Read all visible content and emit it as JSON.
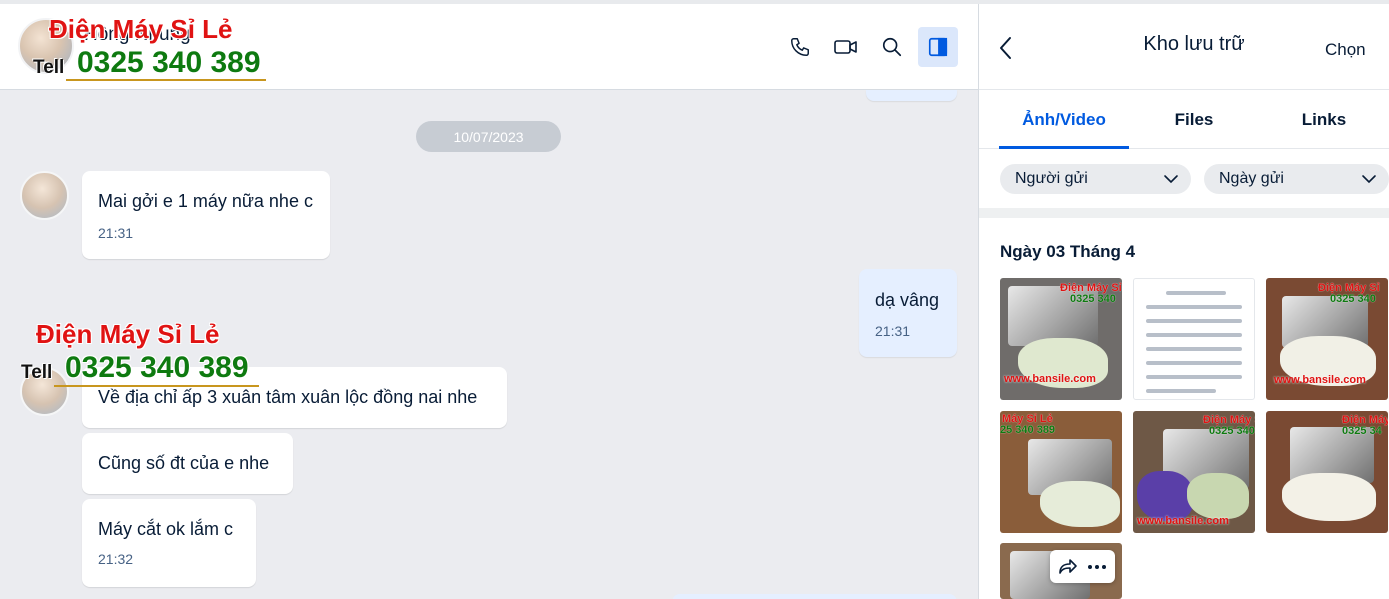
{
  "chat": {
    "header": {
      "name": "Hồng Nhung",
      "buttons": [
        "phone-icon",
        "video-icon",
        "search-icon",
        "panel-icon"
      ]
    },
    "date_separator": "10/07/2023",
    "messages": [
      {
        "text": "Mai gởi e 1 máy nữa nhe c",
        "time": "21:31",
        "from": "contact"
      },
      {
        "text": "dạ vâng",
        "time": "21:31",
        "from": "me"
      },
      {
        "text": "Về địa chỉ ấp 3 xuân tâm xuân lộc đồng nai nhe",
        "time": "",
        "from": "contact"
      },
      {
        "text": "Cũng số đt của e nhe",
        "time": "",
        "from": "contact"
      },
      {
        "text": "Máy cắt ok lắm c",
        "time": "21:32",
        "from": "contact"
      }
    ]
  },
  "watermark": {
    "brand": "Điện Máy Sỉ Lẻ",
    "tell": "Tell",
    "phone": "0325 340 389"
  },
  "panel": {
    "title": "Kho lưu trữ",
    "select_label": "Chọn",
    "tabs": [
      "Ảnh/Video",
      "Files",
      "Links"
    ],
    "active_tab": 0,
    "filters": {
      "sender": "Người gửi",
      "date": "Ngày gửi"
    },
    "section_title": "Ngày 03 Tháng 4",
    "thumbs": [
      {
        "wm_brand": "Điện Máy Sỉ",
        "wm_phone": "0325 340",
        "site": "www.bansile.com"
      },
      {
        "wm_brand": "",
        "wm_phone": "",
        "site": ""
      },
      {
        "wm_brand": "Điện Máy Sỉ",
        "wm_phone": "0325 340",
        "site": "www.bansile.com"
      },
      {
        "wm_brand": "Máy Sỉ Lẻ",
        "wm_phone": "25 340 389",
        "site": ""
      },
      {
        "wm_brand": "Điện Máy S",
        "wm_phone": "0325 340",
        "site": "www.bansile.com"
      },
      {
        "wm_brand": "Điện Máy",
        "wm_phone": "0325 34",
        "site": ""
      },
      {
        "wm_brand": "",
        "wm_phone": "",
        "site": ""
      }
    ]
  },
  "colors": {
    "accent": "#005ae0",
    "my_bubble": "#e5efff",
    "chat_bg": "#ebecf0",
    "watermark_red": "#e01313",
    "watermark_green": "#0e7a10"
  }
}
